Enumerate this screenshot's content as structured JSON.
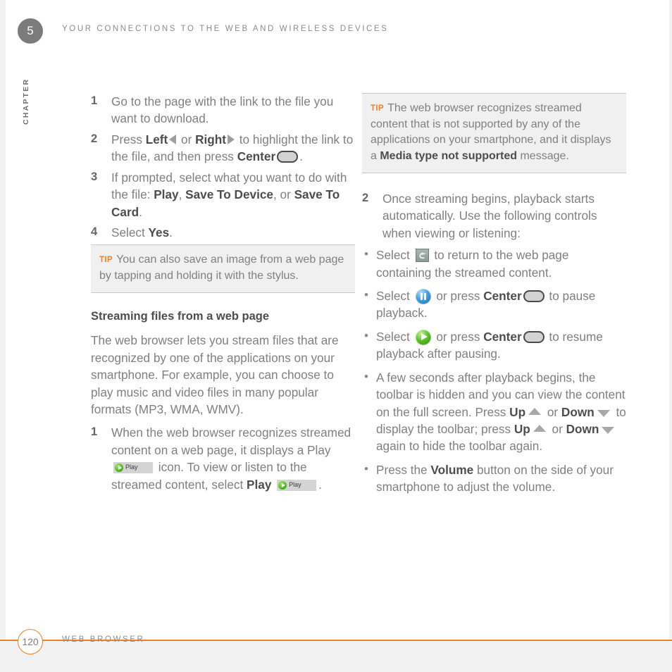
{
  "header": {
    "chapter_number": "5",
    "chapter_label": "CHAPTER",
    "title": "YOUR CONNECTIONS TO THE WEB AND WIRELESS DEVICES"
  },
  "footer": {
    "page_number": "120",
    "section_title": "WEB BROWSER",
    "rule_color": "#f08020"
  },
  "colors": {
    "tip_label": "#f08020",
    "body_text": "#808080",
    "bold_text": "#4d4d4d",
    "tip_background": "#f0f0f0",
    "chapter_badge": "#7b7b7b"
  },
  "left_column": {
    "steps": [
      {
        "num": "1",
        "parts": [
          {
            "t": "Go to the page with the link to the file you want to download."
          }
        ]
      },
      {
        "num": "2",
        "parts": [
          {
            "t": "Press "
          },
          {
            "t": "Left",
            "b": true
          },
          {
            "icon": "left-triangle-icon"
          },
          {
            "t": " or "
          },
          {
            "t": "Right",
            "b": true
          },
          {
            "icon": "right-triangle-icon"
          },
          {
            "t": " to highlight the link to the file, and then press "
          },
          {
            "t": "Center",
            "b": true
          },
          {
            "icon": "center-button-icon"
          },
          {
            "t": "."
          }
        ]
      },
      {
        "num": "3",
        "parts": [
          {
            "t": "If prompted, select what you want to do with the file: "
          },
          {
            "t": "Play",
            "b": true
          },
          {
            "t": ", "
          },
          {
            "t": "Save To Device",
            "b": true
          },
          {
            "t": ", or "
          },
          {
            "t": "Save To Card",
            "b": true
          },
          {
            "t": "."
          }
        ]
      },
      {
        "num": "4",
        "parts": [
          {
            "t": "Select "
          },
          {
            "t": "Yes",
            "b": true
          },
          {
            "t": "."
          }
        ]
      }
    ],
    "tip": {
      "label": "TIP",
      "parts": [
        {
          "t": "You can also save an image from a web page by tapping and holding it with the stylus."
        }
      ]
    },
    "section_heading": "Streaming files from a web page",
    "section_body": "The web browser lets you stream files that are recognized by one of the applications on your smartphone. For example, you can choose to play music and video files in many popular formats (MP3, WMA, WMV).",
    "step_after": {
      "num": "1",
      "parts": [
        {
          "t": "When the web browser recognizes streamed content on a web page, it displays a Play "
        },
        {
          "icon": "play-chip-icon"
        },
        {
          "t": " icon. To view or listen to the streamed content, select "
        },
        {
          "t": "Play",
          "b": true
        },
        {
          "t": " "
        },
        {
          "icon": "play-chip-icon"
        },
        {
          "t": "."
        }
      ]
    }
  },
  "right_column": {
    "tip": {
      "label": "TIP",
      "parts": [
        {
          "t": "The web browser recognizes streamed content that is not supported by any of the applications on your smartphone, and it displays a "
        },
        {
          "t": "Media type not supported",
          "b": true
        },
        {
          "t": " message."
        }
      ]
    },
    "step": {
      "num": "2",
      "parts": [
        {
          "t": "Once streaming begins, playback starts automatically. Use the following controls when viewing or listening:"
        }
      ]
    },
    "bullets": [
      {
        "parts": [
          {
            "t": "Select "
          },
          {
            "icon": "back-button-icon"
          },
          {
            "t": " to return to the web page containing the streamed content."
          }
        ]
      },
      {
        "parts": [
          {
            "t": "Select "
          },
          {
            "icon": "pause-button-icon"
          },
          {
            "t": " or press "
          },
          {
            "t": "Center",
            "b": true
          },
          {
            "icon": "center-button-icon"
          },
          {
            "t": " to pause playback."
          }
        ]
      },
      {
        "parts": [
          {
            "t": "Select "
          },
          {
            "icon": "play-button-icon"
          },
          {
            "t": " or press "
          },
          {
            "t": "Center",
            "b": true
          },
          {
            "icon": "center-button-icon"
          },
          {
            "t": " to resume playback after pausing."
          }
        ]
      },
      {
        "parts": [
          {
            "t": "A few seconds after playback begins, the toolbar is hidden and you can view the content on the full screen. Press "
          },
          {
            "t": "Up",
            "b": true
          },
          {
            "icon": "up-triangle-icon"
          },
          {
            "t": " or "
          },
          {
            "t": "Down",
            "b": true
          },
          {
            "icon": "down-triangle-icon"
          },
          {
            "t": " to display the toolbar; press "
          },
          {
            "t": "Up",
            "b": true
          },
          {
            "icon": "up-triangle-icon"
          },
          {
            "t": " or "
          },
          {
            "t": "Down",
            "b": true
          },
          {
            "icon": "down-triangle-icon"
          },
          {
            "t": " again to hide the toolbar again."
          }
        ]
      },
      {
        "parts": [
          {
            "t": "Press the "
          },
          {
            "t": "Volume",
            "b": true
          },
          {
            "t": " button on the side of your smartphone to adjust the volume."
          }
        ]
      }
    ]
  },
  "play_chip": {
    "label": "Play"
  }
}
